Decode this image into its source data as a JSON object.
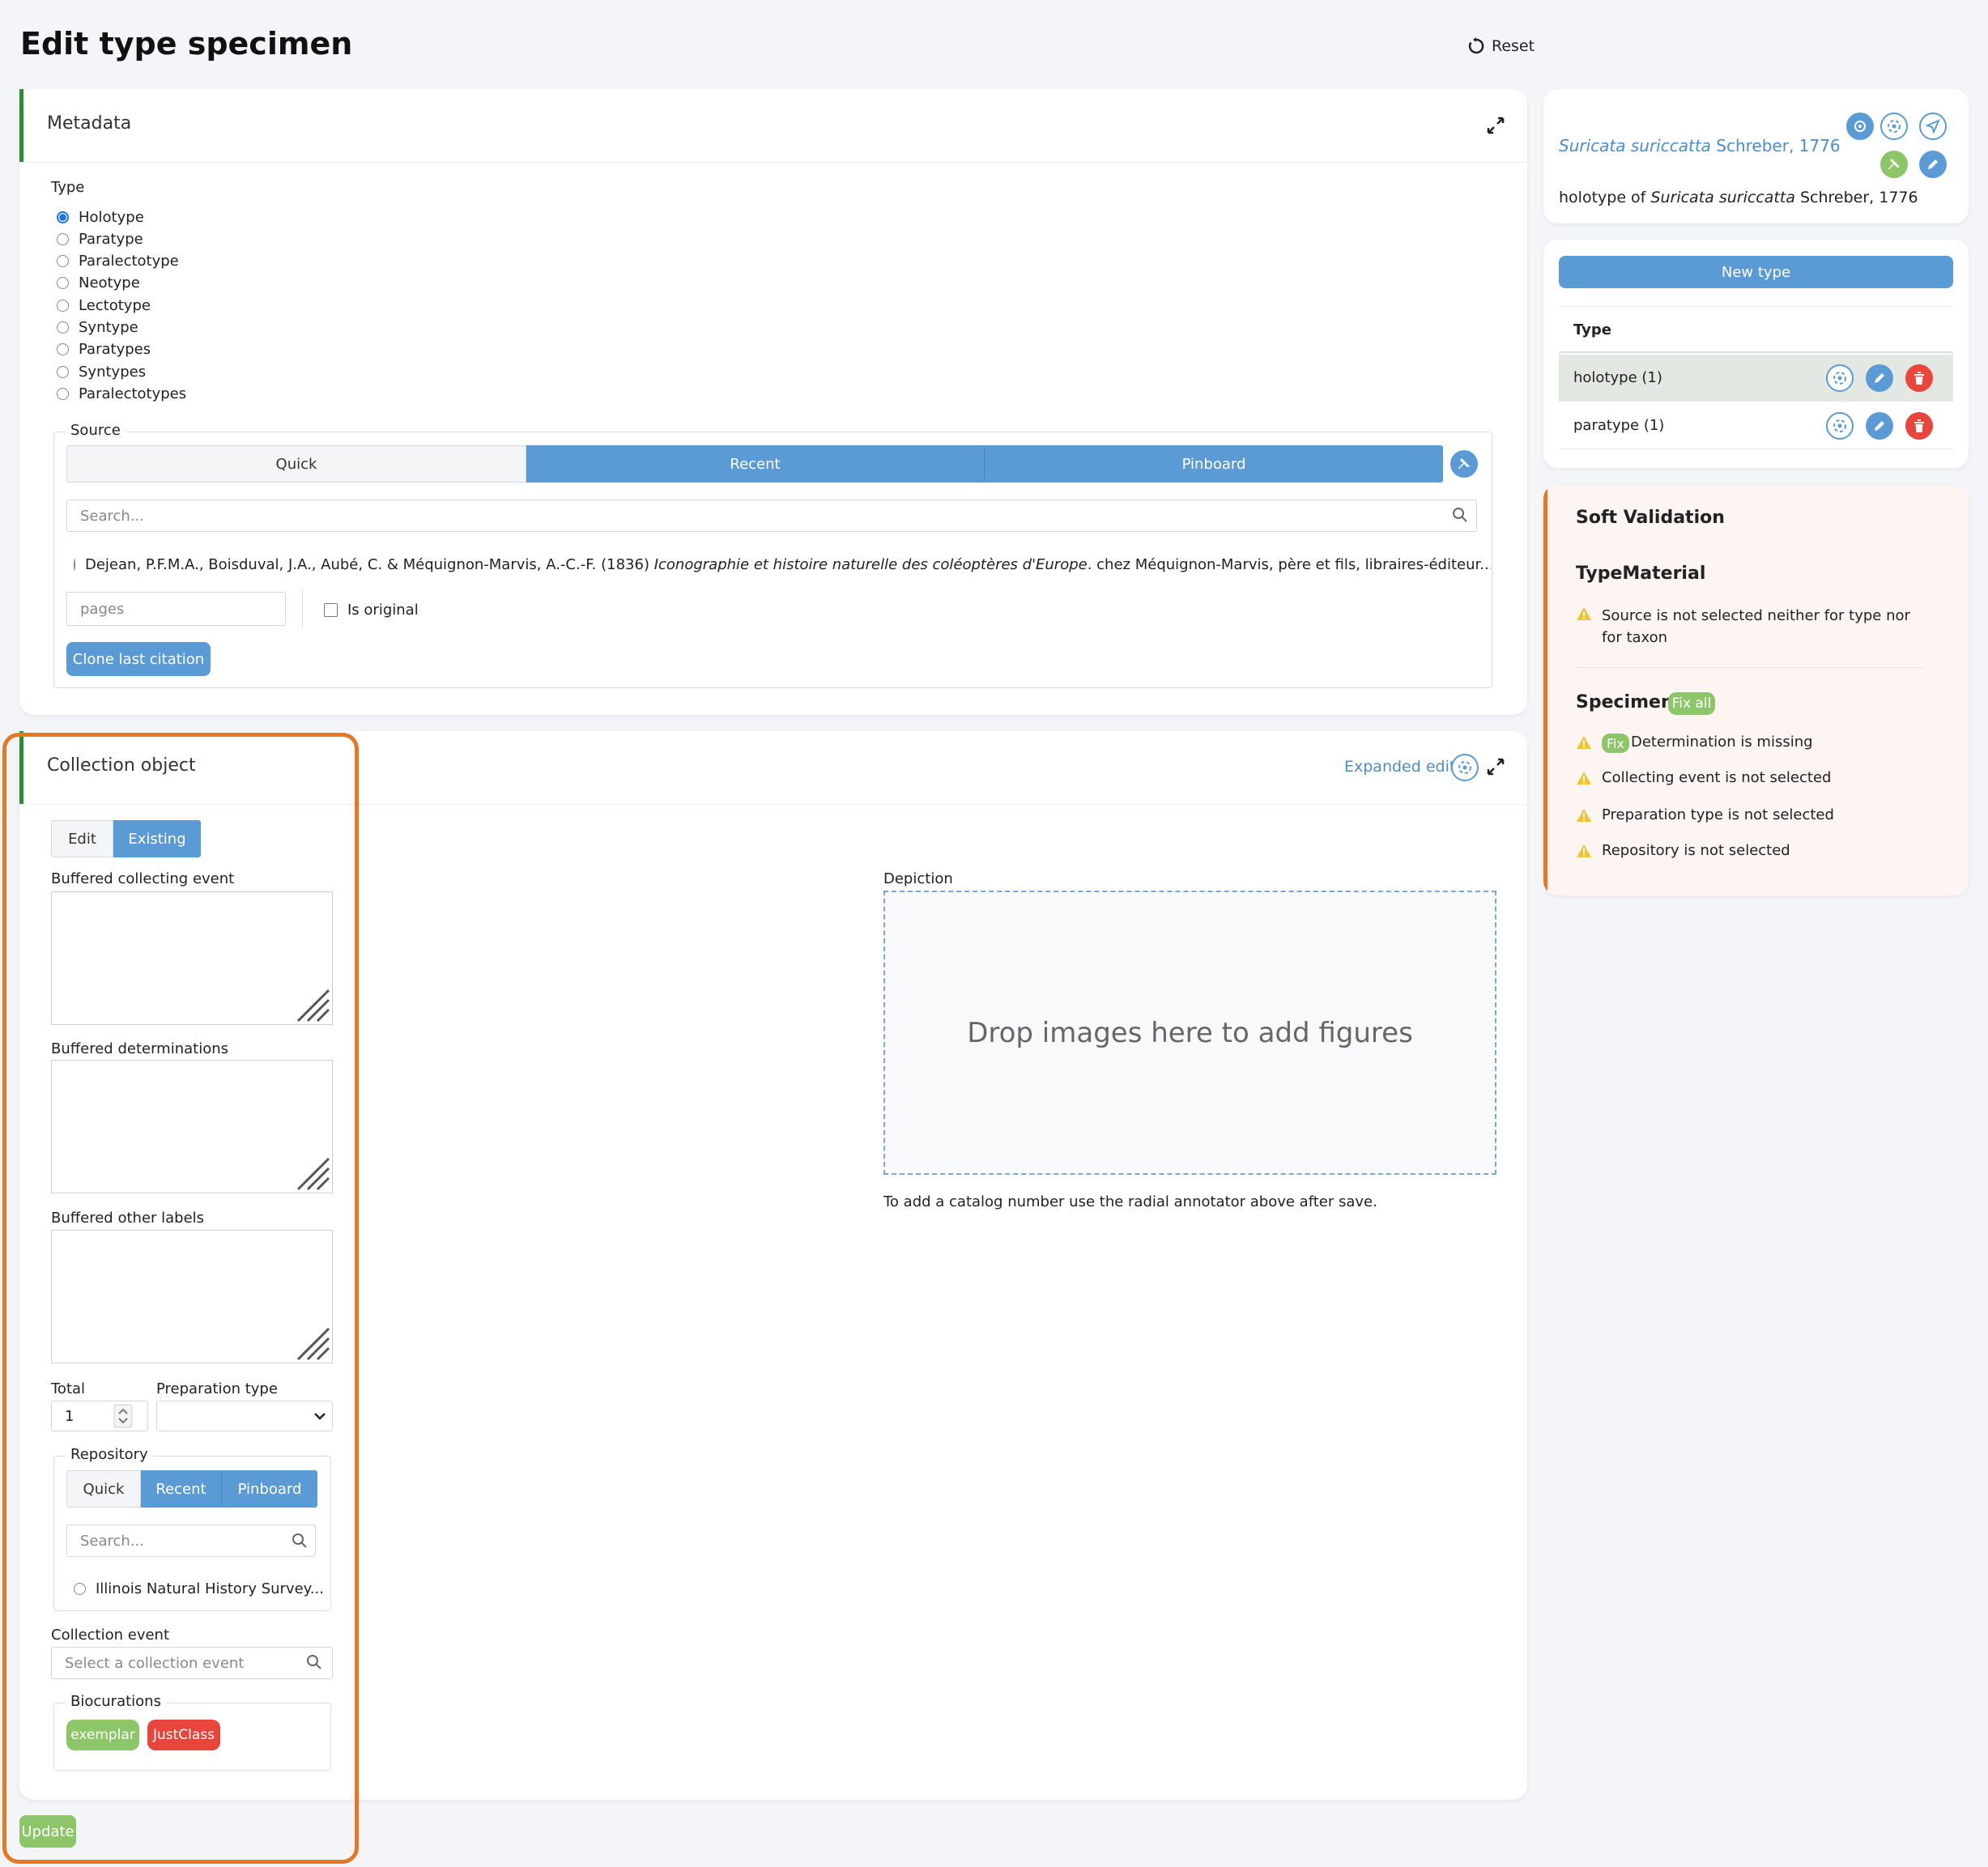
{
  "page": {
    "title": "Edit type specimen",
    "reset_label": "Reset"
  },
  "metadata": {
    "title": "Metadata",
    "type_label": "Type",
    "types": [
      "Holotype",
      "Paratype",
      "Paralectotype",
      "Neotype",
      "Lectotype",
      "Syntype",
      "Paratypes",
      "Syntypes",
      "Paralectotypes"
    ],
    "selected_type": "Holotype",
    "source": {
      "legend": "Source",
      "tabs": [
        "Quick",
        "Recent",
        "Pinboard"
      ],
      "search_placeholder": "Search...",
      "citation_plain_1": "Dejean, P.F.M.A., Boisduval, J.A., Aubé, C. & Méquignon-Marvis, A.-C.-F. (1836) ",
      "citation_italic": "Iconographie et histoire naturelle des coléoptères d'Europe",
      "citation_plain_2": ". chez Méquignon-Marvis, père et fils, libraires-éditeur...",
      "pages_placeholder": "pages",
      "is_original_label": "Is original",
      "clone_label": "Clone last citation"
    }
  },
  "collection_object": {
    "title": "Collection object",
    "expanded_edit_label": "Expanded edit",
    "tabs": [
      "Edit",
      "Existing"
    ],
    "buffered_collecting_event_label": "Buffered collecting event",
    "buffered_determinations_label": "Buffered determinations",
    "buffered_other_labels_label": "Buffered other labels",
    "total_label": "Total",
    "total_value": "1",
    "preparation_type_label": "Preparation type",
    "repository": {
      "legend": "Repository",
      "tabs": [
        "Quick",
        "Recent",
        "Pinboard"
      ],
      "search_placeholder": "Search...",
      "option": "Illinois Natural History Survey..."
    },
    "collection_event_label": "Collection event",
    "collection_event_placeholder": "Select a collection event",
    "biocurations": {
      "legend": "Biocurations",
      "items": [
        "exemplar",
        "JustClass"
      ]
    },
    "depiction": {
      "label": "Depiction",
      "drop_text": "Drop images here to add figures",
      "note": "To add a catalog number use the radial annotator above after save."
    },
    "update_label": "Update"
  },
  "summary": {
    "taxon_italic": "Suricata suriccatta",
    "taxon_author": " Schreber, 1776",
    "holotype_prefix": "holotype of ",
    "holotype_taxon": "Suricata suriccatta",
    "holotype_author": " Schreber, 1776"
  },
  "type_list": {
    "new_type_label": "New type",
    "header": "Type",
    "rows": [
      "holotype (1)",
      "paratype (1)"
    ]
  },
  "soft_validation": {
    "title": "Soft Validation",
    "type_material": {
      "title": "TypeMaterial",
      "messages": [
        "Source is not selected neither for type nor for taxon"
      ]
    },
    "specimen": {
      "title": "Specimen",
      "fix_all_label": "Fix all",
      "fix_label": "Fix",
      "messages": [
        "Determination is missing",
        "Collecting event is not selected",
        "Preparation type is not selected",
        "Repository is not selected"
      ]
    }
  },
  "colors": {
    "accent": "#5b9bd5",
    "highlight": "#e87722",
    "danger": "#e8453c",
    "success": "#8cc668"
  }
}
